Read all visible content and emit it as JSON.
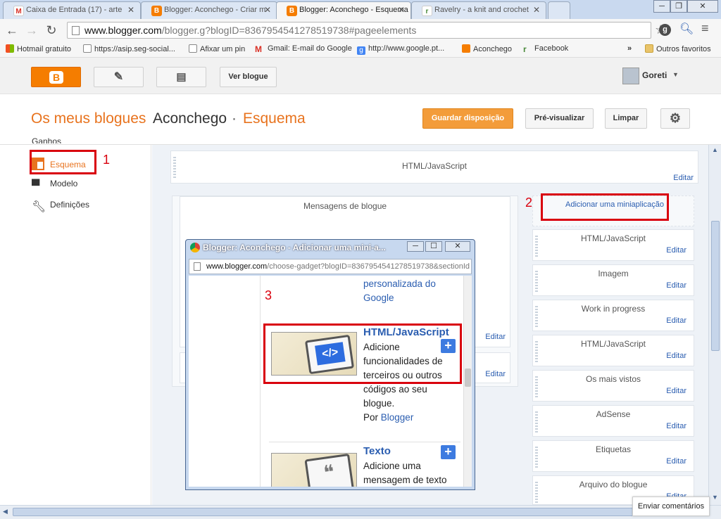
{
  "browser": {
    "tabs": [
      {
        "title": "Caixa de Entrada (17) - arte",
        "icon": "gmail-icon"
      },
      {
        "title": "Blogger: Aconchego - Criar m",
        "icon": "blogger-icon"
      },
      {
        "title": "Blogger: Aconchego - Esquema",
        "icon": "blogger-icon",
        "active": true
      },
      {
        "title": "Ravelry - a knit and crochet",
        "icon": "ravelry-icon"
      }
    ],
    "url_host": "www.blogger.com",
    "url_path": "/blogger.g?blogID=8367954541278519738#pageelements",
    "bookmarks": [
      "Hotmail gratuito",
      "https://asip.seg-social...",
      "Afixar um pin",
      "Gmail: E-mail do Google",
      "http://www.google.pt...",
      "Aconchego",
      "Facebook"
    ],
    "bookmarks_more": "»",
    "other_bookmarks": "Outros favoritos"
  },
  "header": {
    "view_blog": "Ver blogue",
    "user": "Goreti",
    "my_blogs": "Os meus blogues",
    "blog_name": "Aconchego",
    "separator": "·",
    "section": "Esquema",
    "save_layout": "Guardar disposição",
    "preview": "Pré-visualizar",
    "clear": "Limpar"
  },
  "sidebar": {
    "partial_item": "Ganhos",
    "items": [
      {
        "label": "Esquema",
        "icon": "layout-icon",
        "active": true
      },
      {
        "label": "Modelo",
        "icon": "paint-roller-icon"
      },
      {
        "label": "Definições",
        "icon": "wrench-icon"
      }
    ]
  },
  "layout": {
    "top_gadget": "HTML/JavaScript",
    "edit": "Editar",
    "main_posts": "Mensagens de blogue",
    "add_gadget": "Adicionar uma miniaplicação",
    "right_gadgets": [
      "HTML/JavaScript",
      "Imagem",
      "Work in progress",
      "HTML/JavaScript",
      "Os mais vistos",
      "AdSense",
      "Etiquetas",
      "Arquivo do blogue"
    ]
  },
  "annotations": {
    "n1": "1",
    "n2": "2",
    "n3": "3",
    "color": "#d9000d"
  },
  "popup": {
    "title": "Blogger: Aconchego - Adicionar uma mini-a...",
    "url_host": "www.blogger.com",
    "url_path": "/choose-gadget?blogID=8367954541278519738&sectionId",
    "prev_line1": "personalizada do",
    "prev_line2": "Google",
    "gadget1": {
      "title": "HTML/JavaScript",
      "desc": [
        "Adicione",
        "funcionalidades de",
        "terceiros ou outros",
        "códigos ao seu",
        "blogue."
      ],
      "by": "Por",
      "author": "Blogger"
    },
    "gadget2": {
      "title": "Texto",
      "desc": [
        "Adicione uma",
        "mensagem de texto"
      ]
    }
  },
  "feedback": "Enviar comentários"
}
